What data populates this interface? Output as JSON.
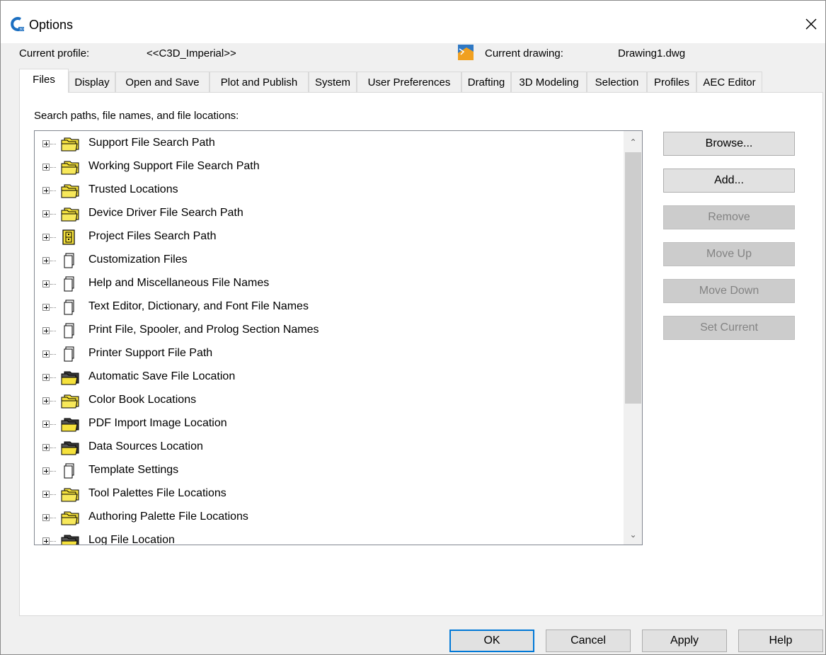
{
  "window": {
    "title": "Options"
  },
  "profile": {
    "current_profile_label": "Current profile:",
    "current_profile_value": "<<C3D_Imperial>>",
    "current_drawing_label": "Current drawing:",
    "current_drawing_value": "Drawing1.dwg"
  },
  "tabs": [
    {
      "label": "Files",
      "active": true
    },
    {
      "label": "Display",
      "active": false
    },
    {
      "label": "Open and Save",
      "active": false
    },
    {
      "label": "Plot and Publish",
      "active": false
    },
    {
      "label": "System",
      "active": false
    },
    {
      "label": "User Preferences",
      "active": false
    },
    {
      "label": "Drafting",
      "active": false
    },
    {
      "label": "3D Modeling",
      "active": false
    },
    {
      "label": "Selection",
      "active": false
    },
    {
      "label": "Profiles",
      "active": false
    },
    {
      "label": "AEC Editor",
      "active": false
    }
  ],
  "files_panel": {
    "section_label": "Search paths, file names, and file locations:",
    "tree_items": [
      {
        "label": "Support File Search Path",
        "icon": "yellow-folders-icon"
      },
      {
        "label": "Working Support File Search Path",
        "icon": "yellow-folders-icon"
      },
      {
        "label": "Trusted Locations",
        "icon": "yellow-folders-icon"
      },
      {
        "label": "Device Driver File Search Path",
        "icon": "yellow-folders-icon"
      },
      {
        "label": "Project Files Search Path",
        "icon": "project-cabinet-icon"
      },
      {
        "label": "Customization Files",
        "icon": "file-stack-icon"
      },
      {
        "label": "Help and Miscellaneous File Names",
        "icon": "file-stack-icon"
      },
      {
        "label": "Text Editor, Dictionary, and Font File Names",
        "icon": "file-stack-icon"
      },
      {
        "label": "Print File, Spooler, and Prolog Section Names",
        "icon": "file-stack-icon"
      },
      {
        "label": "Printer Support File Path",
        "icon": "file-stack-icon"
      },
      {
        "label": "Automatic Save File Location",
        "icon": "dark-folders-icon"
      },
      {
        "label": "Color Book Locations",
        "icon": "yellow-folders-icon"
      },
      {
        "label": "PDF Import Image Location",
        "icon": "dark-folders-icon"
      },
      {
        "label": "Data Sources Location",
        "icon": "dark-folders-icon"
      },
      {
        "label": "Template Settings",
        "icon": "file-stack-icon"
      },
      {
        "label": "Tool Palettes File Locations",
        "icon": "yellow-folders-icon"
      },
      {
        "label": "Authoring Palette File Locations",
        "icon": "yellow-folders-icon"
      },
      {
        "label": "Log File Location",
        "icon": "dark-folders-icon"
      }
    ],
    "buttons": [
      {
        "label": "Browse...",
        "enabled": true
      },
      {
        "label": "Add...",
        "enabled": true
      },
      {
        "label": "Remove",
        "enabled": false
      },
      {
        "label": "Move Up",
        "enabled": false
      },
      {
        "label": "Move Down",
        "enabled": false
      },
      {
        "label": "Set Current",
        "enabled": false
      }
    ]
  },
  "footer": {
    "ok_label": "OK",
    "cancel_label": "Cancel",
    "apply_label": "Apply",
    "help_label": "Help"
  },
  "colors": {
    "accent": "#0078d7",
    "folder_yellow": "#f5e13c",
    "disabled_button": "#cccccc"
  }
}
